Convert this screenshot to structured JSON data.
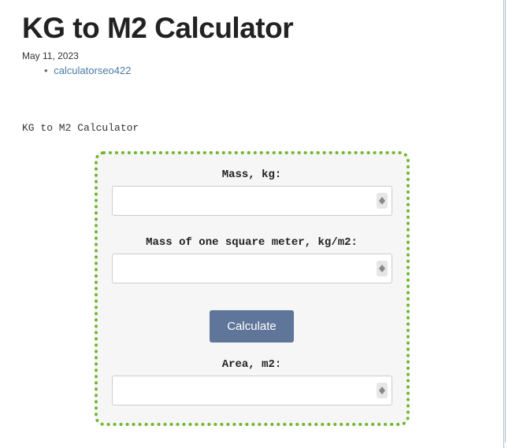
{
  "page": {
    "title": "KG to M2 Calculator",
    "date": "May 11, 2023",
    "author": "calculatorseo422"
  },
  "calculator": {
    "heading": "KG to M2 Calculator",
    "fields": {
      "mass": {
        "label": "Mass, kg:",
        "value": ""
      },
      "density": {
        "label": "Mass of one square meter, kg/m2:",
        "value": ""
      },
      "area": {
        "label": "Area, m2:",
        "value": ""
      }
    },
    "button_label": "Calculate"
  },
  "icons": {
    "spinner": "number-spinner-icon"
  }
}
